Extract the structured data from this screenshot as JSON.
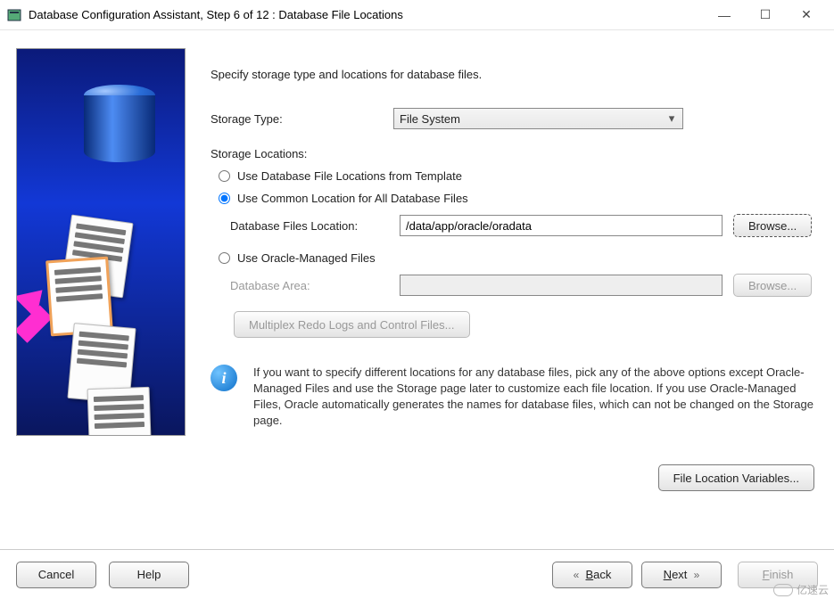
{
  "window": {
    "title": "Database Configuration Assistant, Step 6 of 12 : Database File Locations"
  },
  "main": {
    "heading": "Specify storage type and locations for database files.",
    "storage_type_label": "Storage Type:",
    "storage_type_value": "File System",
    "storage_locations_label": "Storage Locations:",
    "radio_template": "Use Database File Locations from Template",
    "radio_common": "Use Common Location for All Database Files",
    "db_files_location_label": "Database Files Location:",
    "db_files_location_value": "/data/app/oracle/oradata",
    "browse1": "Browse...",
    "radio_omf": "Use Oracle-Managed Files",
    "db_area_label": "Database Area:",
    "db_area_value": "",
    "browse2": "Browse...",
    "multiplex_btn": "Multiplex Redo Logs and Control Files...",
    "info_text": "If you want to specify different locations for any database files, pick any of the above options except Oracle-Managed Files and use the Storage page later to customize each file location. If you use Oracle-Managed Files, Oracle automatically generates the names for database files, which can not be changed on the Storage page.",
    "file_loc_vars_btn": "File Location Variables..."
  },
  "footer": {
    "cancel": "Cancel",
    "help": "Help",
    "back": "Back",
    "next": "Next",
    "finish": "Finish"
  },
  "watermark": {
    "text": "亿速云"
  }
}
